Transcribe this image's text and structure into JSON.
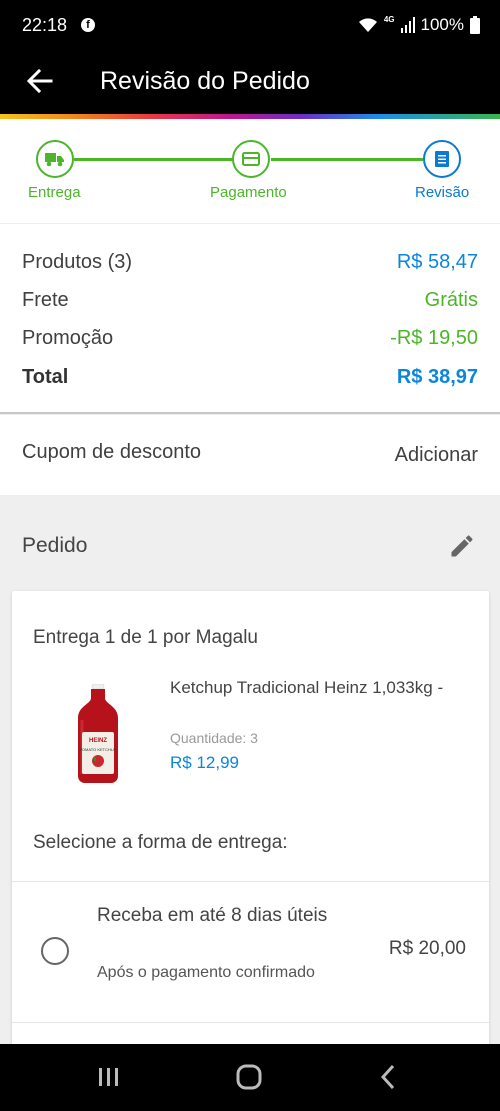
{
  "status_bar": {
    "time": "22:18",
    "fb_icon": "f",
    "network": "4G",
    "battery": "100%"
  },
  "header": {
    "title": "Revisão do Pedido"
  },
  "steps": [
    {
      "label": "Entrega",
      "icon": "truck-icon"
    },
    {
      "label": "Pagamento",
      "icon": "card-icon"
    },
    {
      "label": "Revisão",
      "icon": "receipt-icon"
    }
  ],
  "summary": {
    "products_label": "Produtos (3)",
    "products_value": "R$ 58,47",
    "shipping_label": "Frete",
    "shipping_value": "Grátis",
    "promo_label": "Promoção",
    "promo_value": "-R$ 19,50",
    "total_label": "Total",
    "total_value": "R$ 38,97"
  },
  "coupon": {
    "label": "Cupom de desconto",
    "action": "Adicionar"
  },
  "order": {
    "title": "Pedido",
    "shipment_title": "Entrega 1 de 1 por Magalu",
    "product": {
      "name": "Ketchup Tradicional Heinz 1,033kg -",
      "quantity": "Quantidade:  3",
      "price": "R$ 12,99",
      "label_brand": "HEINZ",
      "label_type": "TOMATO KETCHUP"
    },
    "select_title": "Selecione a forma de entrega:",
    "option": {
      "title": "Receba em até 8 dias úteis",
      "subtitle": "Após o pagamento confirmado",
      "price": "R$ 20,00"
    }
  },
  "colors": {
    "green": "#4cb52a",
    "blue": "#0b86dc",
    "accent_active": "#0b7ad2"
  }
}
